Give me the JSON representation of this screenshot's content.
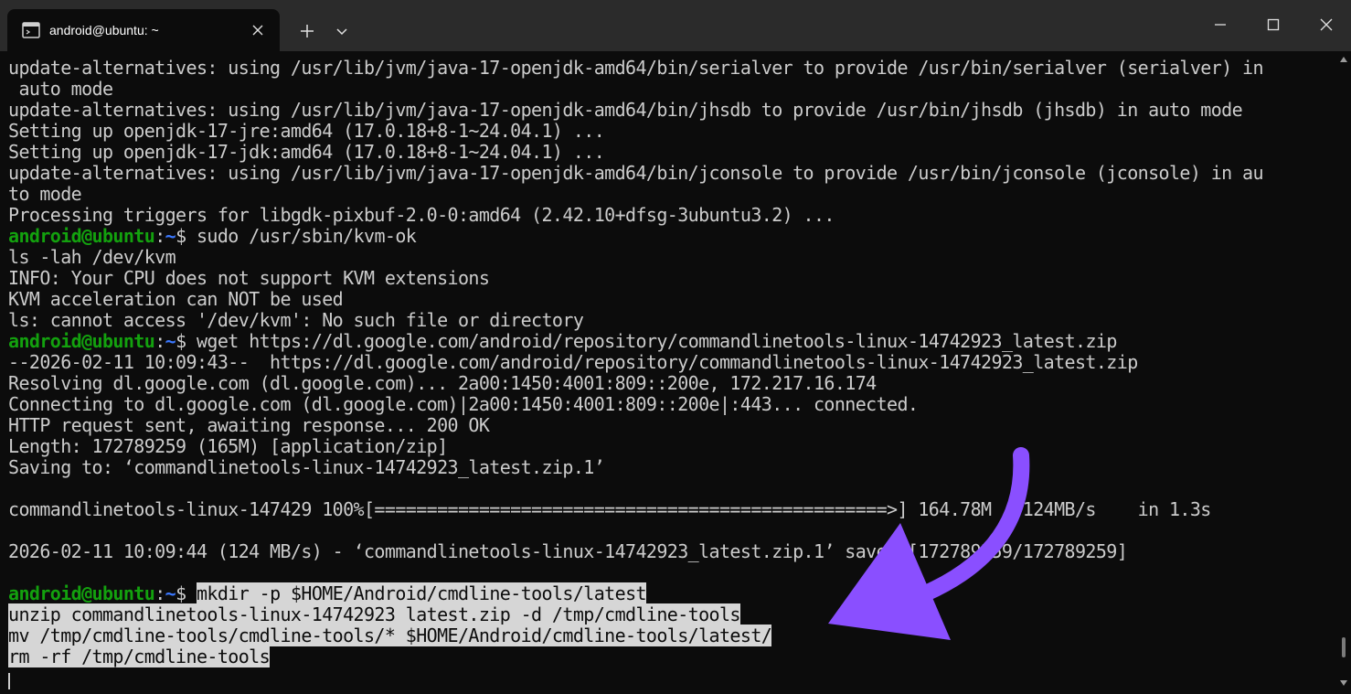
{
  "window": {
    "tab_title": "android@ubuntu: ~",
    "tab_icon": "terminal-icon",
    "icons": {
      "close": "close-icon",
      "new_tab": "plus-icon",
      "dropdown": "chevron-down-icon",
      "minimize": "minimize-icon",
      "maximize": "maximize-icon",
      "window_close": "close-icon"
    }
  },
  "terminal": {
    "colors": {
      "background": "#0c0c0c",
      "foreground": "#cccccc",
      "prompt_user": "#13a10e",
      "prompt_path": "#3b78ff",
      "selection": "#d6d6d6",
      "arrow": "#8a4fff"
    },
    "scroll_position": 0.97,
    "lines": [
      {
        "text": "update-alternatives: using /usr/lib/jvm/java-17-openjdk-amd64/bin/serialver to provide /usr/bin/serialver (serialver) in"
      },
      {
        "text": " auto mode"
      },
      {
        "text": "update-alternatives: using /usr/lib/jvm/java-17-openjdk-amd64/bin/jhsdb to provide /usr/bin/jhsdb (jhsdb) in auto mode"
      },
      {
        "text": "Setting up openjdk-17-jre:amd64 (17.0.18+8-1~24.04.1) ..."
      },
      {
        "text": "Setting up openjdk-17-jdk:amd64 (17.0.18+8-1~24.04.1) ..."
      },
      {
        "text": "update-alternatives: using /usr/lib/jvm/java-17-openjdk-amd64/bin/jconsole to provide /usr/bin/jconsole (jconsole) in au"
      },
      {
        "text": "to mode"
      },
      {
        "text": "Processing triggers for libgdk-pixbuf-2.0-0:amd64 (2.42.10+dfsg-3ubuntu3.2) ..."
      },
      {
        "prompt": {
          "user": "android@ubuntu",
          "sep": ":",
          "path": "~",
          "sign": "$ "
        },
        "text": "sudo /usr/sbin/kvm-ok"
      },
      {
        "text": "ls -lah /dev/kvm"
      },
      {
        "text": "INFO: Your CPU does not support KVM extensions"
      },
      {
        "text": "KVM acceleration can NOT be used"
      },
      {
        "text": "ls: cannot access '/dev/kvm': No such file or directory"
      },
      {
        "prompt": {
          "user": "android@ubuntu",
          "sep": ":",
          "path": "~",
          "sign": "$ "
        },
        "text": "wget https://dl.google.com/android/repository/commandlinetools-linux-14742923_latest.zip"
      },
      {
        "text": "--2026-02-11 10:09:43--  https://dl.google.com/android/repository/commandlinetools-linux-14742923_latest.zip"
      },
      {
        "text": "Resolving dl.google.com (dl.google.com)... 2a00:1450:4001:809::200e, 172.217.16.174"
      },
      {
        "text": "Connecting to dl.google.com (dl.google.com)|2a00:1450:4001:809::200e|:443... connected."
      },
      {
        "text": "HTTP request sent, awaiting response... 200 OK"
      },
      {
        "text": "Length: 172789259 (165M) [application/zip]"
      },
      {
        "text": "Saving to: ‘commandlinetools-linux-14742923_latest.zip.1’"
      },
      {
        "text": ""
      },
      {
        "text": "commandlinetools-linux-147429 100%[=================================================>] 164.78M   124MB/s    in 1.3s"
      },
      {
        "text": ""
      },
      {
        "text": "2026-02-11 10:09:44 (124 MB/s) - ‘commandlinetools-linux-14742923_latest.zip.1’ saved [172789259/172789259]"
      },
      {
        "text": ""
      },
      {
        "prompt": {
          "user": "android@ubuntu",
          "sep": ":",
          "path": "~",
          "sign": "$ "
        },
        "text": "mkdir -p $HOME/Android/cmdline-tools/latest",
        "selected": true
      },
      {
        "text": "unzip commandlinetools-linux-14742923_latest.zip -d /tmp/cmdline-tools",
        "selected": true
      },
      {
        "text": "mv /tmp/cmdline-tools/cmdline-tools/* $HOME/Android/cmdline-tools/latest/",
        "selected": true
      },
      {
        "text": "rm -rf /tmp/cmdline-tools",
        "selected": true
      }
    ]
  }
}
